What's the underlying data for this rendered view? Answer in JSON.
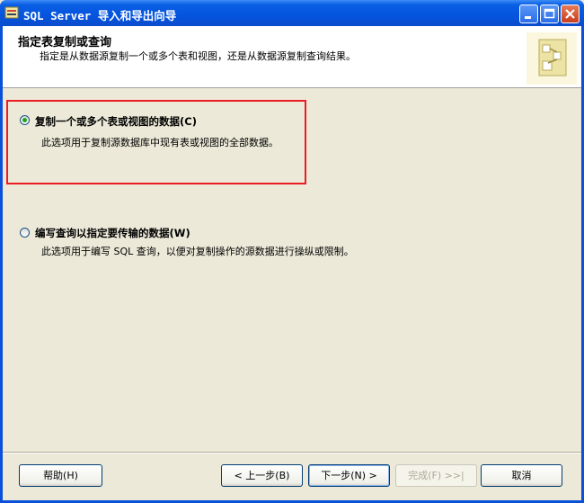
{
  "window": {
    "title": "SQL Server 导入和导出向导"
  },
  "header": {
    "title": "指定表复制或查询",
    "subtitle": "指定是从数据源复制一个或多个表和视图，还是从数据源复制查询结果。"
  },
  "options": [
    {
      "label": "复制一个或多个表或视图的数据(C)",
      "description": "此选项用于复制源数据库中现有表或视图的全部数据。",
      "selected": true
    },
    {
      "label": "编写查询以指定要传输的数据(W)",
      "description": "此选项用于编写 SQL 查询，以便对复制操作的源数据进行操纵或限制。",
      "selected": false
    }
  ],
  "buttons": {
    "help": "帮助(H)",
    "back": "< 上一步(B)",
    "next": "下一步(N) >",
    "finish": "完成(F) >>|",
    "cancel": "取消"
  },
  "colors": {
    "highlight_border": "#ec1c24",
    "titlebar": "#0554de"
  }
}
